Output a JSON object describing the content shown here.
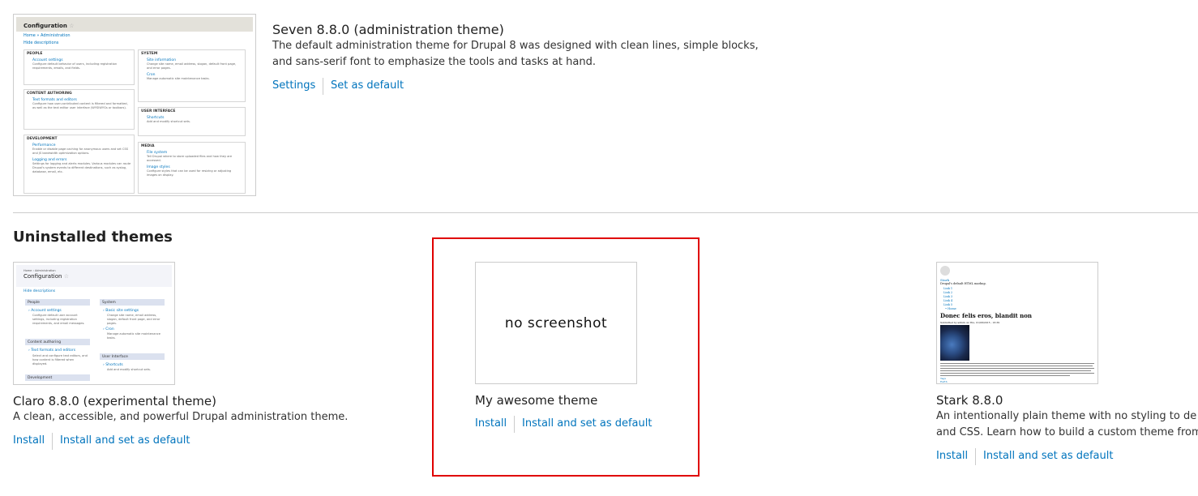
{
  "installed": {
    "seven": {
      "title": "Seven 8.8.0 (administration theme)",
      "description_line1": "The default administration theme for Drupal 8 was designed with clean lines, simple blocks,",
      "description_line2": "and sans-serif font to emphasize the tools and tasks at hand.",
      "actions": {
        "settings": "Settings",
        "set_default": "Set as default"
      },
      "thumbnail": {
        "header": "Configuration",
        "breadcrumb": "Home » Administration",
        "hide": "Hide descriptions",
        "people": "PEOPLE",
        "account_settings": "Account settings",
        "content_authoring": "CONTENT AUTHORING",
        "text_formats": "Text formats and editors",
        "development": "DEVELOPMENT",
        "performance": "Performance",
        "logging": "Logging and errors",
        "system": "SYSTEM",
        "site_info": "Site information",
        "cron": "Cron",
        "user_interface": "USER INTERFACE",
        "shortcuts": "Shortcuts",
        "media": "MEDIA",
        "file_system": "File system",
        "image_styles": "Image styles"
      }
    }
  },
  "uninstalled": {
    "heading": "Uninstalled themes",
    "themes": [
      {
        "title": "Claro 8.8.0 (experimental theme)",
        "description": "A clean, accessible, and powerful Drupal administration theme.",
        "install": "Install",
        "install_default": "Install and set as default",
        "thumbnail": {
          "header": "Configuration",
          "hide": "Hide descriptions",
          "people": "People",
          "system": "System",
          "account": "Account settings",
          "site_info": "Basic site settings",
          "cron": "Cron",
          "content": "Content authoring",
          "text_formats": "Text formats and editors",
          "ui": "User Interface",
          "shortcuts": "Shortcuts",
          "development": "Development"
        }
      },
      {
        "title": "My awesome theme",
        "screenshot_placeholder": "no screenshot",
        "install": "Install",
        "install_default": "Install and set as default"
      },
      {
        "title": "Stark 8.8.0",
        "description_line1": "An intentionally plain theme with no styling to de",
        "description_line2": "and CSS. Learn how to build a custom theme from",
        "install": "Install",
        "install_default": "Install and set as default",
        "thumbnail": {
          "heading": "Donec felis eros, blandit non"
        }
      }
    ]
  },
  "highlight_color": "#e00000",
  "link_color": "#0074bd"
}
